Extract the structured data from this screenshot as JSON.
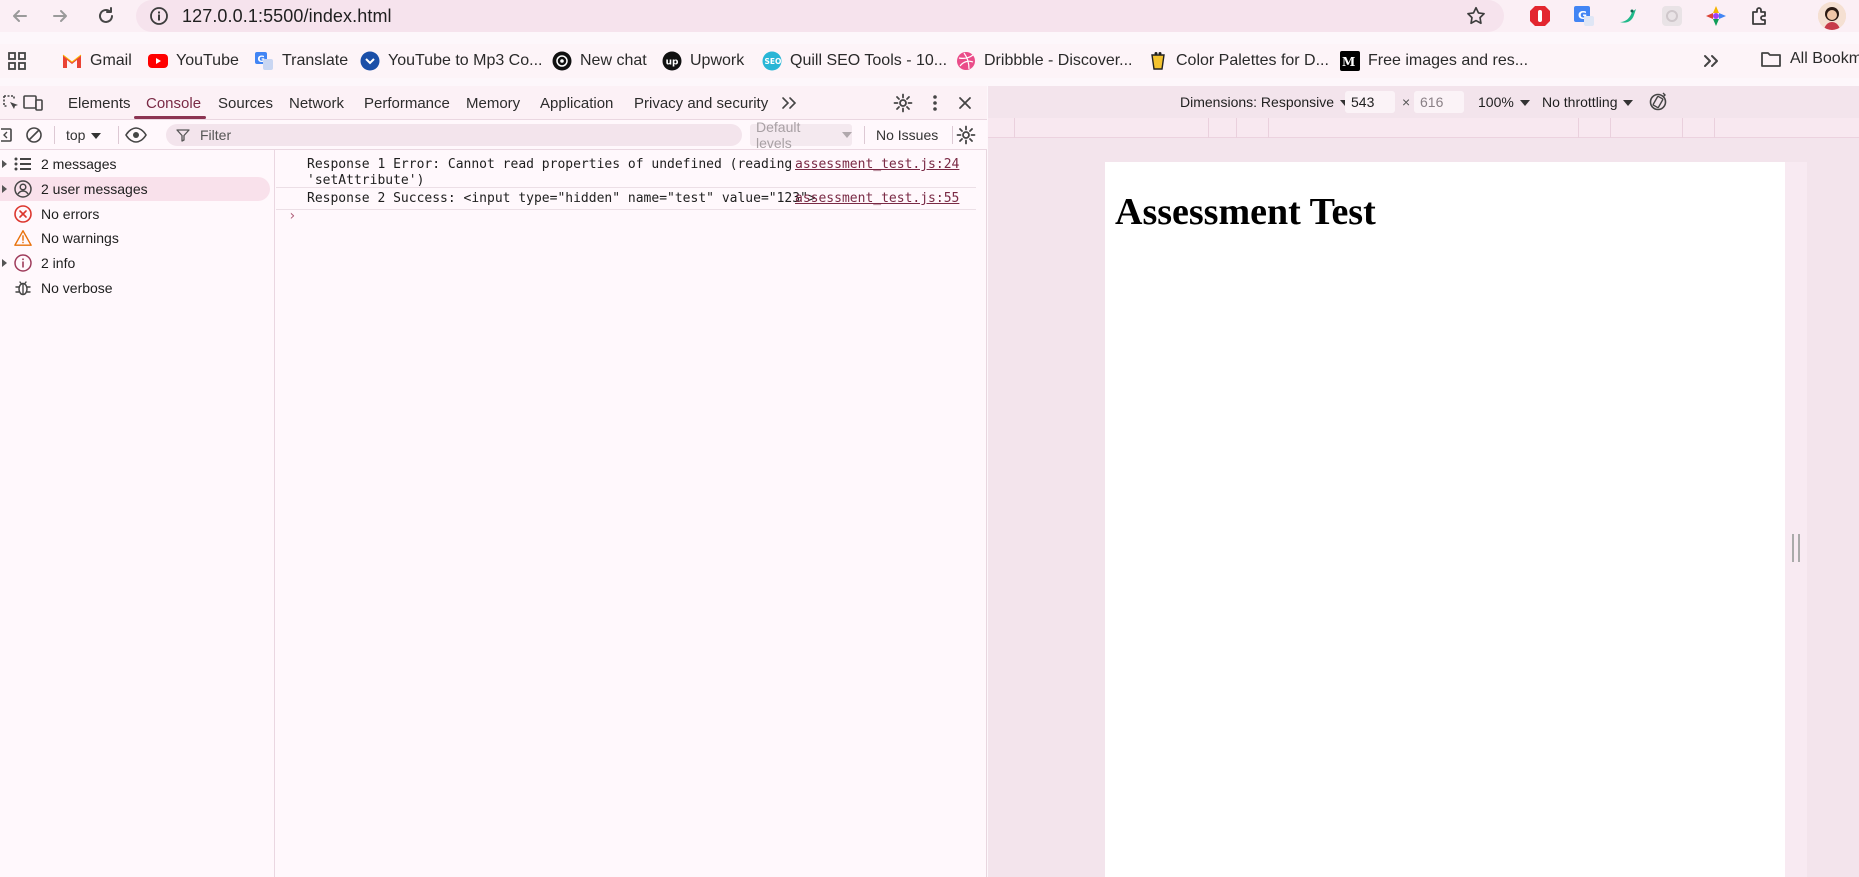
{
  "browser": {
    "url": "127.0.0.1:5500/index.html"
  },
  "bookmarks": {
    "items": [
      {
        "label": "Gmail",
        "icon": "gmail-icon",
        "color": "#ea4335"
      },
      {
        "label": "YouTube",
        "icon": "youtube-icon",
        "color": "#ff0000"
      },
      {
        "label": "Translate",
        "icon": "translate-icon",
        "color": "#4285f4"
      },
      {
        "label": "YouTube to Mp3 Co...",
        "icon": "download-icon",
        "color": "#1a4fa8"
      },
      {
        "label": "New chat",
        "icon": "openai-icon",
        "color": "#111111"
      },
      {
        "label": "Upwork",
        "icon": "upwork-icon",
        "color": "#111111"
      },
      {
        "label": "Quill SEO Tools - 10...",
        "icon": "seo-icon",
        "color": "#29b6d6"
      },
      {
        "label": "Dribbble - Discover...",
        "icon": "dribbble-icon",
        "color": "#ea4c89"
      },
      {
        "label": "Color Palettes for D...",
        "icon": "palette-icon",
        "color": "#222222"
      },
      {
        "label": "Free images and res...",
        "icon": "image-icon",
        "color": "#000000"
      }
    ],
    "all_label": "All Bookm"
  },
  "devtools": {
    "tabs": [
      "Elements",
      "Console",
      "Sources",
      "Network",
      "Performance",
      "Memory",
      "Application",
      "Privacy and security"
    ],
    "active_tab": "Console",
    "toolbar": {
      "context": "top",
      "filter_placeholder": "Filter",
      "levels": "Default levels",
      "issues": "No Issues"
    },
    "sidebar": [
      {
        "label": "2 messages",
        "icon": "list-icon"
      },
      {
        "label": "2 user messages",
        "icon": "user-icon"
      },
      {
        "label": "No errors",
        "icon": "error-icon"
      },
      {
        "label": "No warnings",
        "icon": "warning-icon"
      },
      {
        "label": "2 info",
        "icon": "info-icon"
      },
      {
        "label": "No verbose",
        "icon": "bug-icon"
      }
    ],
    "console": [
      {
        "text": "Response 1 Error: Cannot read properties of undefined (reading\n'setAttribute')",
        "source": "assessment_test.js:24"
      },
      {
        "text": "Response 2 Success: <input type=\"hidden\" name=\"test\" value=\"123\">",
        "source": "assessment_test.js:55"
      }
    ],
    "prompt": "›"
  },
  "device": {
    "dimensions_label": "Dimensions: Responsive",
    "width": "543",
    "height": "616",
    "times": "×",
    "zoom": "100%",
    "throttling": "No throttling",
    "page_heading": "Assessment Test"
  }
}
